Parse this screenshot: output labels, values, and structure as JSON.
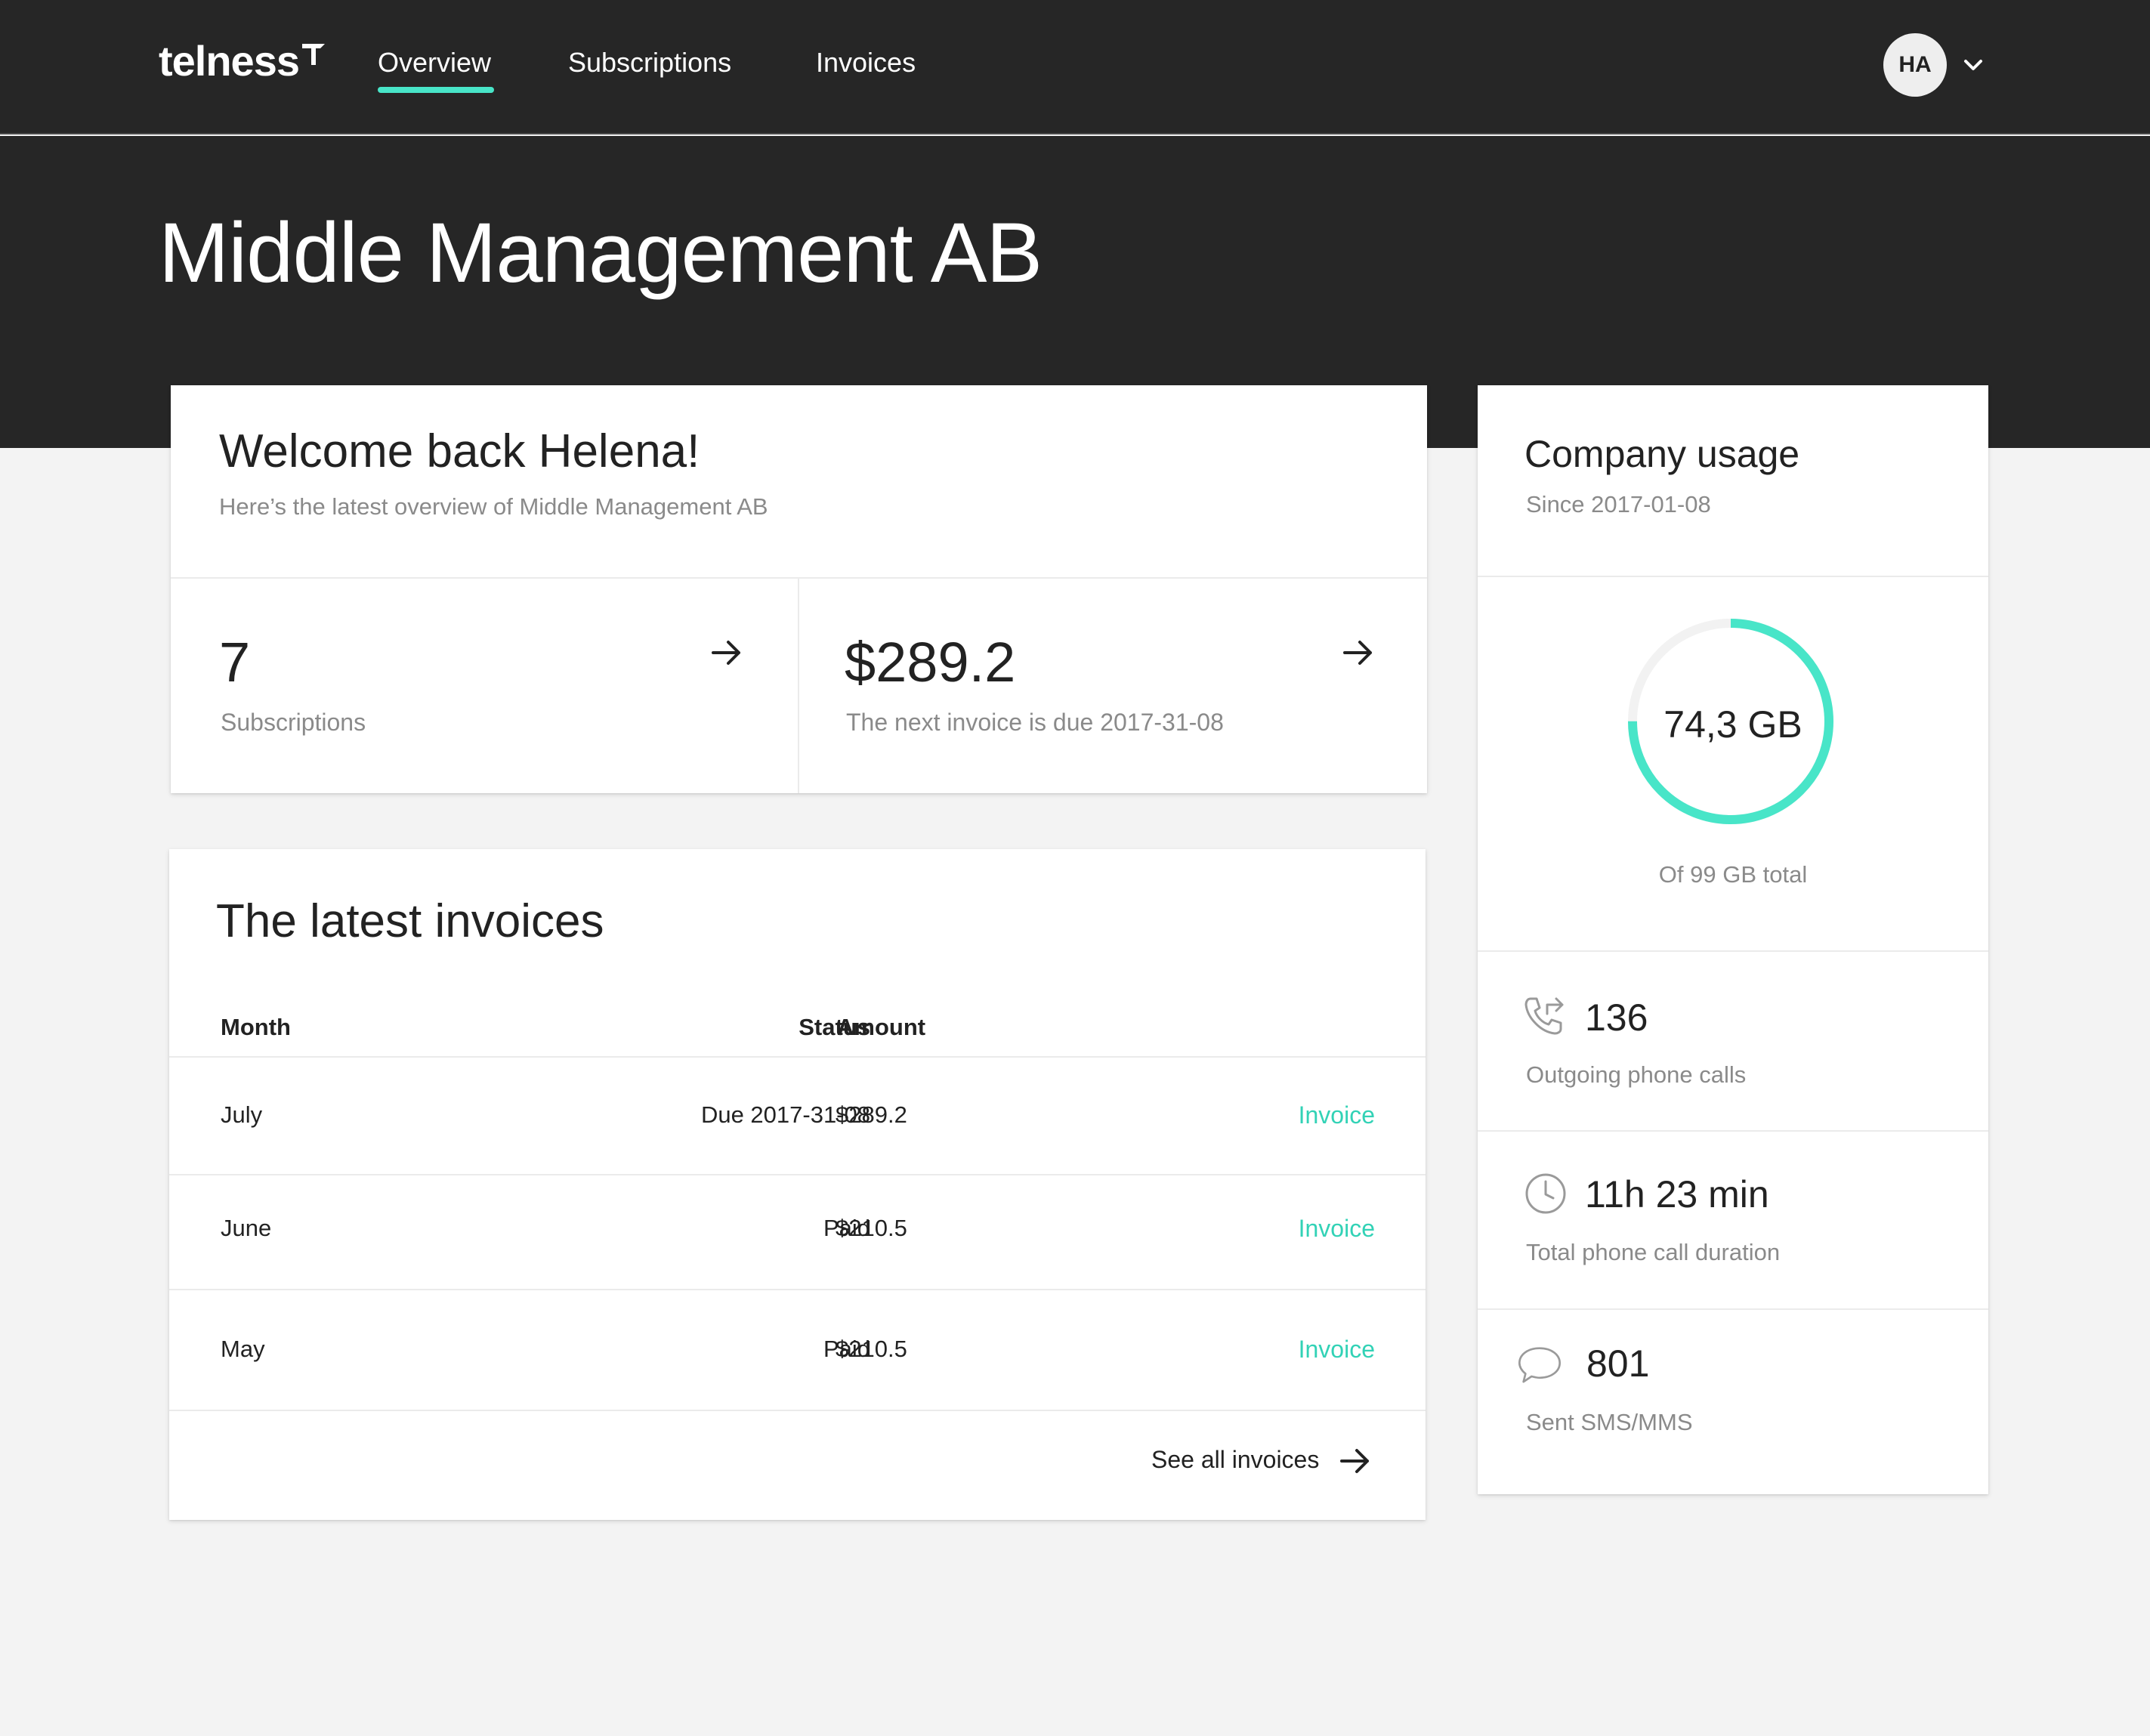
{
  "header": {
    "logo": "telness",
    "nav": [
      {
        "label": "Overview"
      },
      {
        "label": "Subscriptions"
      },
      {
        "label": "Invoices"
      }
    ],
    "avatar_initials": "HA"
  },
  "page_title": "Middle Management AB",
  "welcome": {
    "title": "Welcome back Helena!",
    "subtitle": "Here’s the latest overview of Middle Management AB",
    "subscriptions_count": "7",
    "subscriptions_label": "Subscriptions",
    "next_invoice_amount": "$289.2",
    "next_invoice_label": "The next invoice is due 2017-31-08"
  },
  "invoices": {
    "title": "The latest invoices",
    "columns": {
      "month": "Month",
      "status": "Status",
      "amount": "Amount"
    },
    "rows": [
      {
        "month": "July",
        "status": "Due 2017-31-08",
        "amount": "$289.2",
        "link": "Invoice"
      },
      {
        "month": "June",
        "status": "Paid",
        "amount": "$210.5",
        "link": "Invoice"
      },
      {
        "month": "May",
        "status": "Paid",
        "amount": "$210.5",
        "link": "Invoice"
      }
    ],
    "see_all": "See all invoices"
  },
  "usage": {
    "title": "Company usage",
    "since": "Since 2017-01-08",
    "data_used": "74,3 GB",
    "data_total_label": "Of 99 GB total",
    "data_fraction": 0.75,
    "outgoing_calls": "136",
    "outgoing_calls_label": "Outgoing phone calls",
    "call_duration": "11h 23 min",
    "call_duration_label": "Total phone call duration",
    "sms_count": "801",
    "sms_label": "Sent SMS/MMS"
  },
  "colors": {
    "header_bg": "#262626",
    "accent": "#48e5c8",
    "link": "#32d2b6",
    "page_bg": "#f3f3f3"
  },
  "icons": [
    "chevron-down-icon",
    "arrow-right-icon",
    "phone-outgoing-icon",
    "clock-icon",
    "chat-bubble-icon"
  ]
}
